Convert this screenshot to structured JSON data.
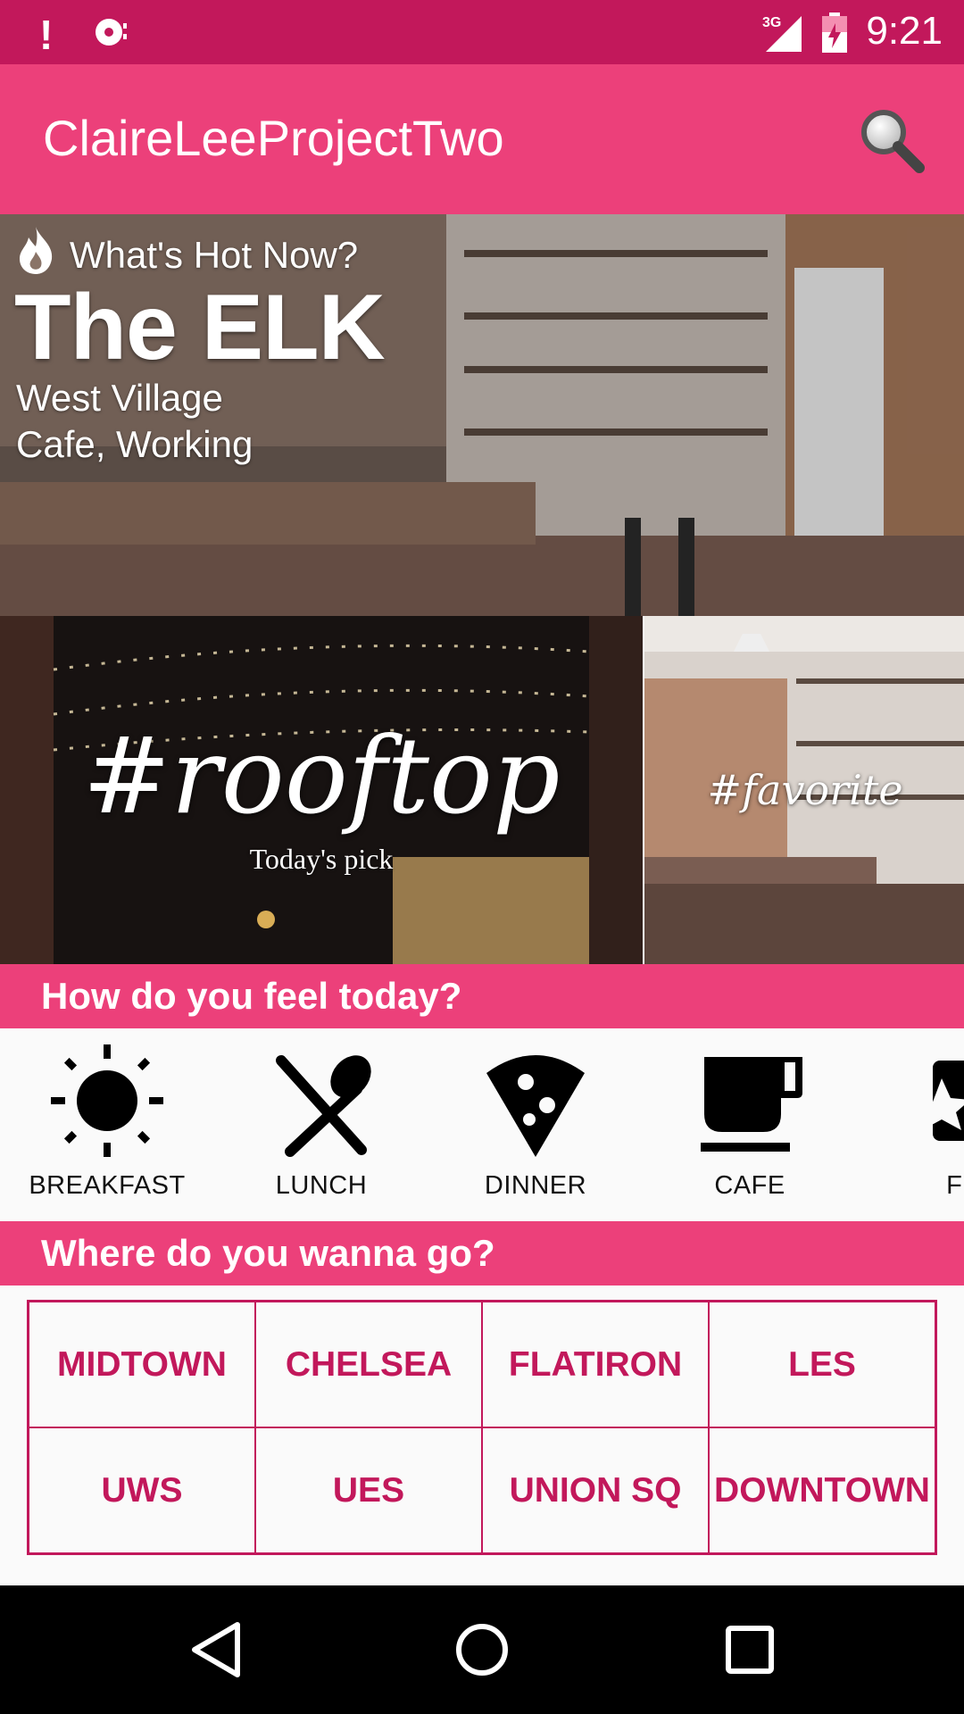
{
  "status_bar": {
    "time": "9:21",
    "network": "3G",
    "alert": "!"
  },
  "app_bar": {
    "title": "ClaireLeeProjectTwo",
    "search_icon": "search-icon"
  },
  "hero": {
    "kicker": "What's Hot Now?",
    "name": "The ELK",
    "location": "West Village",
    "tags": "Cafe, Working"
  },
  "tiles": {
    "left": {
      "tag": "#rooftop",
      "subtitle": "Today's pick"
    },
    "right": {
      "tag": "#favorite"
    }
  },
  "mood_section": {
    "heading": "How do you feel today?",
    "items": [
      {
        "label": "BREAKFAST",
        "icon": "sun-icon"
      },
      {
        "label": "LUNCH",
        "icon": "fork-spoon-icon"
      },
      {
        "label": "DINNER",
        "icon": "pizza-icon"
      },
      {
        "label": "CAFE",
        "icon": "coffee-cup-icon"
      },
      {
        "label": "FU",
        "icon": "star-icon"
      }
    ]
  },
  "area_section": {
    "heading": "Where do you wanna go?",
    "areas": [
      "MIDTOWN",
      "CHELSEA",
      "FLATIRON",
      "LES",
      "UWS",
      "UES",
      "UNION SQ",
      "DOWNTOWN"
    ]
  },
  "colors": {
    "primary": "#ec407a",
    "primary_dark": "#c2185b"
  }
}
